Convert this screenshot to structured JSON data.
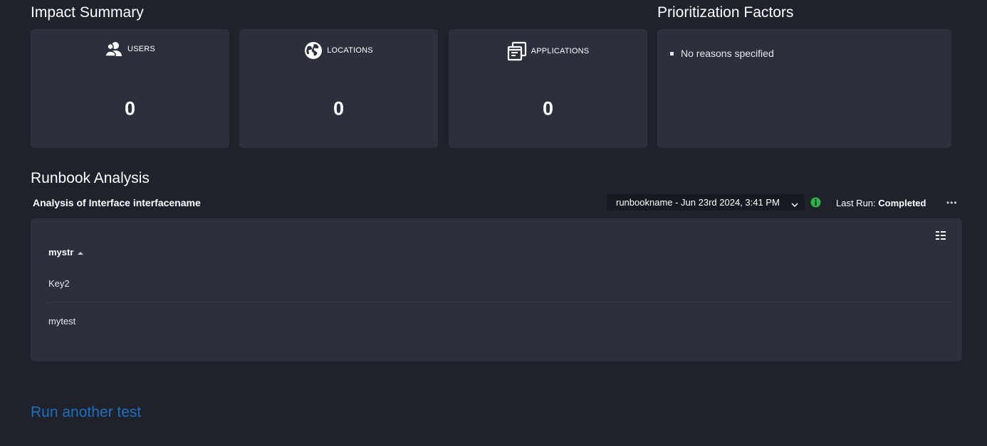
{
  "impact_summary": {
    "title": "Impact Summary",
    "cards": [
      {
        "icon": "users-icon",
        "label": "USERS",
        "value": "0"
      },
      {
        "icon": "globe-icon",
        "label": "LOCATIONS",
        "value": "0"
      },
      {
        "icon": "applications-icon",
        "label": "APPLICATIONS",
        "value": "0"
      }
    ]
  },
  "prioritization": {
    "title": "Prioritization Factors",
    "items": [
      "No reasons specified"
    ]
  },
  "runbook": {
    "title": "Runbook Analysis",
    "subtitle": "Analysis of Interface interfacename",
    "selected_run": "runbookname - Jun 23rd 2024, 3:41 PM",
    "last_run_label": "Last Run:",
    "last_run_status": "Completed",
    "status_color": "#2fb344",
    "table": {
      "columns": [
        "mystr"
      ],
      "sort": "ascending",
      "rows": [
        "Key2",
        "mytest"
      ]
    }
  },
  "actions": {
    "run_another": "Run another test"
  },
  "colors": {
    "background": "#1f222b",
    "card": "#2c303c",
    "link": "#1f6fbf"
  }
}
